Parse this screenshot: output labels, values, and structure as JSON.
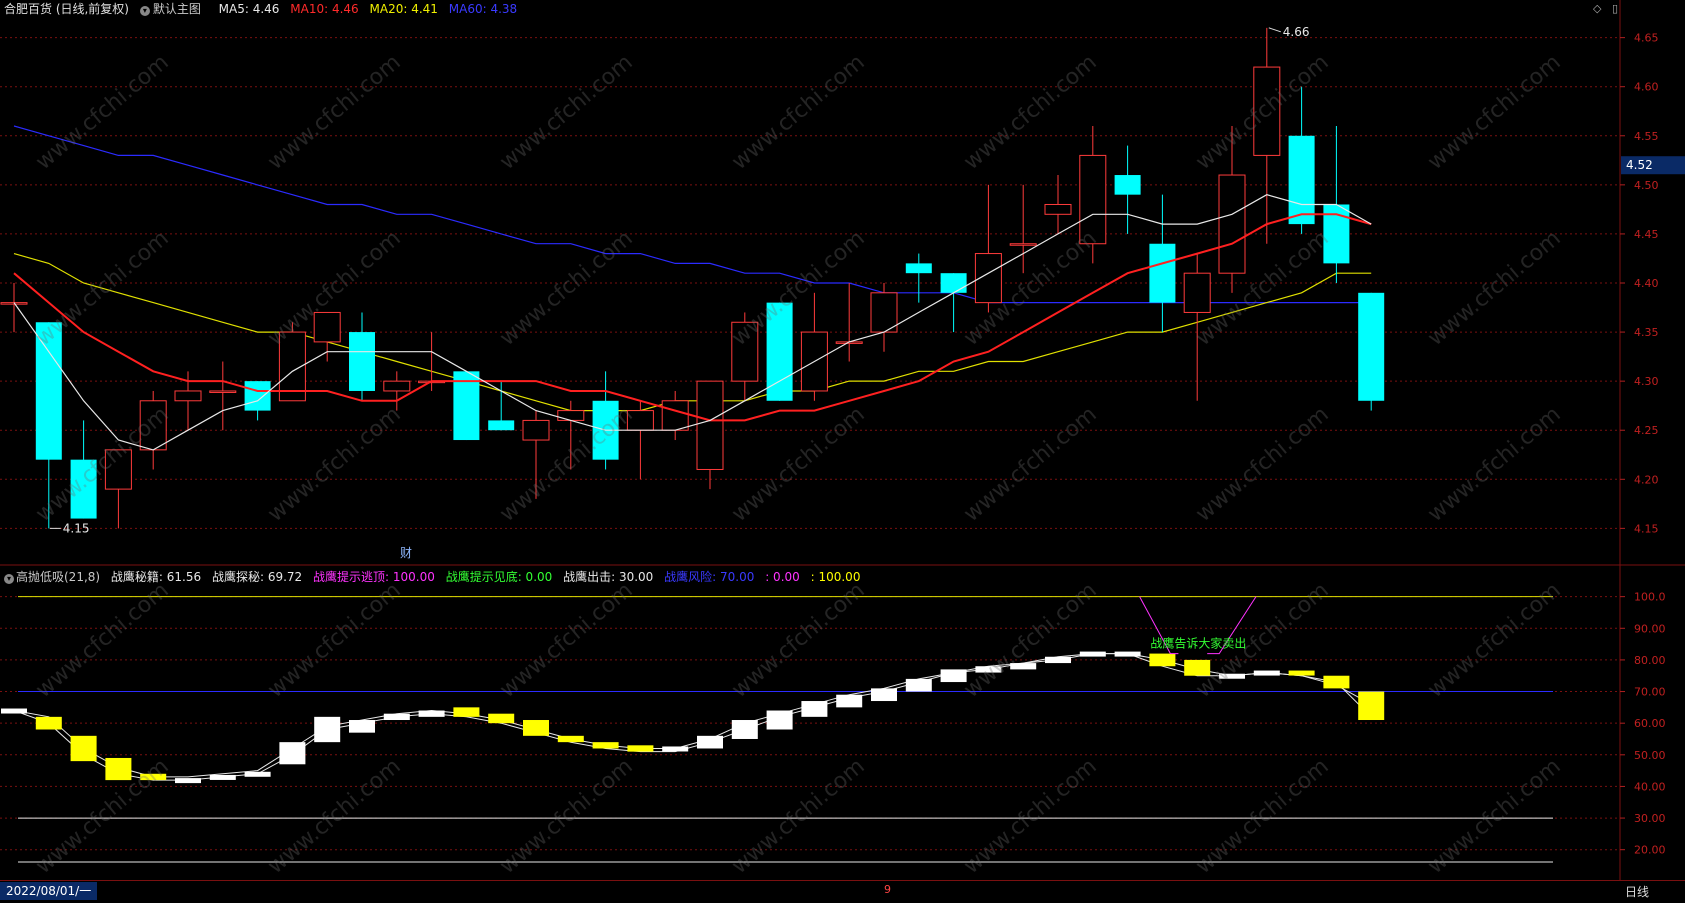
{
  "header": {
    "stock": "合肥百货 (日线,前复权)",
    "template": "默认主图",
    "ma_items": [
      {
        "label": "MA5: 4.46",
        "color": "#e8e8e8"
      },
      {
        "label": "MA10: 4.46",
        "color": "#ff2a2a"
      },
      {
        "label": "MA20: 4.41",
        "color": "#f0f000"
      },
      {
        "label": "MA60: 4.38",
        "color": "#3a3aff"
      }
    ]
  },
  "indicator_header": {
    "name": "高抛低吸(21,8)",
    "items": [
      {
        "label": "战鹰秘籍: 61.56",
        "color": "#e8e8e8"
      },
      {
        "label": "战鹰探秘: 69.72",
        "color": "#e8e8e8"
      },
      {
        "label": "战鹰提示逃顶: 100.00",
        "color": "#ff33ff"
      },
      {
        "label": "战鹰提示见底: 0.00",
        "color": "#33ff33"
      },
      {
        "label": "战鹰出击: 30.00",
        "color": "#e8e8e8"
      },
      {
        "label": "战鹰风险: 70.00",
        "color": "#3a3aff"
      },
      {
        "label": ": 0.00",
        "color": "#ff33ff"
      },
      {
        "label": ": 100.00",
        "color": "#ffff00"
      }
    ]
  },
  "price_axis_ticks": [
    "4.65",
    "4.60",
    "4.55",
    "4.50",
    "4.45",
    "4.40",
    "4.35",
    "4.30",
    "4.25",
    "4.20",
    "4.15"
  ],
  "indicator_axis_ticks": [
    "100.0",
    "90.00",
    "80.00",
    "70.00",
    "60.00",
    "50.00",
    "40.00",
    "30.00",
    "20.00"
  ],
  "current_price_tag": "4.52",
  "annotations": {
    "high": "4.66",
    "low": "4.15",
    "finance_marker": "财",
    "sell_text": "战鹰告诉大家卖出"
  },
  "footer": {
    "date": "2022/08/01/一",
    "period": "日线",
    "mid_marker": "9"
  },
  "watermark": "www.cfchi.com",
  "colors": {
    "up": "#ff3b3b",
    "down": "#00ffff",
    "ma5": "#e8e8e8",
    "ma10": "#ff2020",
    "ma20": "#e0e000",
    "ma60": "#2b2bff",
    "grid": "#7a1010"
  },
  "chart_data": [
    {
      "type": "candlestick",
      "title": "合肥百货 (日线,前复权)",
      "ylim": [
        4.13,
        4.67
      ],
      "ohlc": [
        [
          4.38,
          4.4,
          4.35,
          4.38
        ],
        [
          4.36,
          4.36,
          4.15,
          4.22
        ],
        [
          4.22,
          4.26,
          4.16,
          4.16
        ],
        [
          4.19,
          4.23,
          4.15,
          4.23
        ],
        [
          4.23,
          4.29,
          4.21,
          4.28
        ],
        [
          4.28,
          4.31,
          4.25,
          4.29
        ],
        [
          4.29,
          4.32,
          4.25,
          4.29
        ],
        [
          4.3,
          4.3,
          4.26,
          4.27
        ],
        [
          4.28,
          4.36,
          4.28,
          4.35
        ],
        [
          4.34,
          4.37,
          4.32,
          4.37
        ],
        [
          4.35,
          4.37,
          4.28,
          4.29
        ],
        [
          4.29,
          4.31,
          4.27,
          4.3
        ],
        [
          4.3,
          4.35,
          4.29,
          4.3
        ],
        [
          4.31,
          4.31,
          4.24,
          4.24
        ],
        [
          4.26,
          4.3,
          4.25,
          4.25
        ],
        [
          4.24,
          4.27,
          4.18,
          4.26
        ],
        [
          4.26,
          4.28,
          4.21,
          4.27
        ],
        [
          4.28,
          4.31,
          4.21,
          4.22
        ],
        [
          4.25,
          4.28,
          4.2,
          4.27
        ],
        [
          4.25,
          4.29,
          4.24,
          4.28
        ],
        [
          4.21,
          4.3,
          4.19,
          4.3
        ],
        [
          4.3,
          4.37,
          4.28,
          4.36
        ],
        [
          4.38,
          4.38,
          4.28,
          4.28
        ],
        [
          4.29,
          4.39,
          4.28,
          4.35
        ],
        [
          4.34,
          4.4,
          4.32,
          4.34
        ],
        [
          4.35,
          4.4,
          4.33,
          4.39
        ],
        [
          4.42,
          4.43,
          4.38,
          4.41
        ],
        [
          4.41,
          4.41,
          4.35,
          4.39
        ],
        [
          4.38,
          4.5,
          4.37,
          4.43
        ],
        [
          4.44,
          4.5,
          4.41,
          4.44
        ],
        [
          4.47,
          4.51,
          4.45,
          4.48
        ],
        [
          4.44,
          4.56,
          4.42,
          4.53
        ],
        [
          4.51,
          4.54,
          4.45,
          4.49
        ],
        [
          4.44,
          4.49,
          4.35,
          4.38
        ],
        [
          4.37,
          4.43,
          4.28,
          4.41
        ],
        [
          4.41,
          4.56,
          4.39,
          4.51
        ],
        [
          4.53,
          4.66,
          4.44,
          4.62
        ],
        [
          4.55,
          4.6,
          4.45,
          4.46
        ],
        [
          4.48,
          4.56,
          4.4,
          4.42
        ],
        [
          4.39,
          4.39,
          4.27,
          4.28
        ]
      ],
      "ma5": [
        4.38,
        4.33,
        4.28,
        4.24,
        4.23,
        4.25,
        4.27,
        4.28,
        4.31,
        4.33,
        4.33,
        4.33,
        4.33,
        4.31,
        4.29,
        4.27,
        4.26,
        4.25,
        4.25,
        4.25,
        4.26,
        4.28,
        4.3,
        4.32,
        4.34,
        4.35,
        4.37,
        4.39,
        4.41,
        4.43,
        4.45,
        4.47,
        4.47,
        4.46,
        4.46,
        4.47,
        4.49,
        4.48,
        4.48,
        4.46
      ],
      "ma10": [
        4.41,
        4.38,
        4.35,
        4.33,
        4.31,
        4.3,
        4.3,
        4.29,
        4.29,
        4.29,
        4.28,
        4.28,
        4.3,
        4.3,
        4.3,
        4.3,
        4.29,
        4.29,
        4.28,
        4.27,
        4.26,
        4.26,
        4.27,
        4.27,
        4.28,
        4.29,
        4.3,
        4.32,
        4.33,
        4.35,
        4.37,
        4.39,
        4.41,
        4.42,
        4.43,
        4.44,
        4.46,
        4.47,
        4.47,
        4.46
      ],
      "ma20": [
        4.43,
        4.42,
        4.4,
        4.39,
        4.38,
        4.37,
        4.36,
        4.35,
        4.35,
        4.34,
        4.33,
        4.32,
        4.31,
        4.3,
        4.29,
        4.28,
        4.27,
        4.27,
        4.27,
        4.28,
        4.28,
        4.28,
        4.29,
        4.29,
        4.3,
        4.3,
        4.31,
        4.31,
        4.32,
        4.32,
        4.33,
        4.34,
        4.35,
        4.35,
        4.36,
        4.37,
        4.38,
        4.39,
        4.41,
        4.41
      ],
      "ma60": [
        4.56,
        4.55,
        4.54,
        4.53,
        4.53,
        4.52,
        4.51,
        4.5,
        4.49,
        4.48,
        4.48,
        4.47,
        4.47,
        4.46,
        4.45,
        4.44,
        4.44,
        4.43,
        4.43,
        4.42,
        4.42,
        4.41,
        4.41,
        4.4,
        4.4,
        4.39,
        4.39,
        4.39,
        4.38,
        4.38,
        4.38,
        4.38,
        4.38,
        4.38,
        4.38,
        4.38,
        4.38,
        4.38,
        4.38,
        4.38
      ]
    },
    {
      "type": "candlestick",
      "title": "高抛低吸(21,8)",
      "ylim": [
        12,
        104
      ],
      "bars": [
        [
          64,
          64
        ],
        [
          62,
          58
        ],
        [
          56,
          48
        ],
        [
          49,
          42
        ],
        [
          44,
          42
        ],
        [
          42,
          42
        ],
        [
          43,
          43
        ],
        [
          44,
          44
        ],
        [
          47,
          54
        ],
        [
          54,
          62
        ],
        [
          57,
          61
        ],
        [
          61,
          63
        ],
        [
          62,
          64
        ],
        [
          65,
          62
        ],
        [
          63,
          60
        ],
        [
          61,
          56
        ],
        [
          56,
          54
        ],
        [
          54,
          52
        ],
        [
          53,
          51
        ],
        [
          52,
          52
        ],
        [
          52,
          56
        ],
        [
          55,
          61
        ],
        [
          58,
          64
        ],
        [
          62,
          67
        ],
        [
          65,
          69
        ],
        [
          67,
          71
        ],
        [
          70,
          74
        ],
        [
          73,
          77
        ],
        [
          76,
          78
        ],
        [
          77,
          79
        ],
        [
          79,
          81
        ],
        [
          81,
          82
        ],
        [
          82,
          82
        ],
        [
          82,
          78
        ],
        [
          80,
          75
        ],
        [
          75,
          75
        ],
        [
          76,
          76
        ],
        [
          76,
          75
        ],
        [
          75,
          71
        ],
        [
          70,
          61
        ]
      ],
      "line_a": [
        64,
        62,
        52,
        46,
        43,
        43,
        44,
        45,
        52,
        59,
        61,
        63,
        64,
        63,
        61,
        58,
        55,
        53,
        52,
        52,
        55,
        60,
        63,
        66,
        69,
        71,
        74,
        76,
        78,
        79,
        81,
        82,
        82,
        80,
        77,
        75,
        76,
        75,
        73,
        62
      ],
      "line_b": [
        64,
        60,
        50,
        44,
        42,
        42,
        43,
        44,
        50,
        58,
        60,
        62,
        63,
        62,
        60,
        57,
        54,
        52,
        51,
        51,
        54,
        58,
        62,
        65,
        68,
        70,
        73,
        76,
        77,
        79,
        80,
        82,
        82,
        78,
        75,
        75,
        76,
        75,
        72,
        66
      ],
      "level_lines": [
        100,
        70,
        30,
        0
      ]
    }
  ]
}
